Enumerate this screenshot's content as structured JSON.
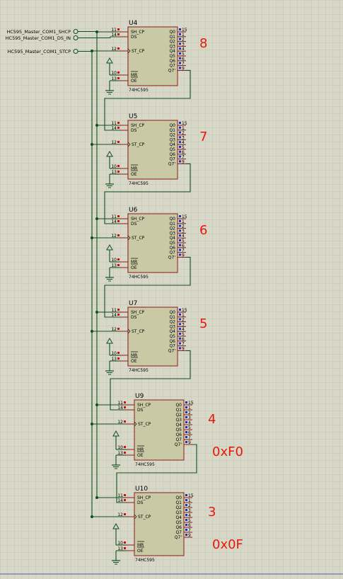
{
  "nets": [
    {
      "label": "HC595_Master_COM1_SHCP"
    },
    {
      "label": "HC595_Master_COM1_DS_IN"
    },
    {
      "label": "HC595_Master_COM1_STCP"
    }
  ],
  "chips": [
    {
      "ref": "U4",
      "part": "74HC595",
      "order": "8",
      "value": ""
    },
    {
      "ref": "U5",
      "part": "74HC595",
      "order": "7",
      "value": ""
    },
    {
      "ref": "U6",
      "part": "74HC595",
      "order": "6",
      "value": ""
    },
    {
      "ref": "U7",
      "part": "74HC595",
      "order": "5",
      "value": ""
    },
    {
      "ref": "U9",
      "part": "74HC595",
      "order": "4",
      "value": "0xF0"
    },
    {
      "ref": "U10",
      "part": "74HC595",
      "order": "3",
      "value": "0x0F"
    }
  ],
  "left_pins": [
    {
      "num": "11",
      "name": "SH_CP"
    },
    {
      "num": "14",
      "name": "DS"
    },
    {
      "num": "12",
      "name": "ST_CP"
    },
    {
      "num": "10",
      "name": "MR"
    },
    {
      "num": "13",
      "name": "OE"
    }
  ],
  "right_pins": [
    {
      "num": "15",
      "name": "Q0"
    },
    {
      "num": "1",
      "name": "Q1"
    },
    {
      "num": "2",
      "name": "Q2"
    },
    {
      "num": "3",
      "name": "Q3"
    },
    {
      "num": "4",
      "name": "Q4"
    },
    {
      "num": "5",
      "name": "Q5"
    },
    {
      "num": "6",
      "name": "Q6"
    },
    {
      "num": "7",
      "name": "Q7"
    },
    {
      "num": "9",
      "name": "Q7'"
    }
  ],
  "colors": {
    "background": "#d8d8c8",
    "grid": "#c4c4b2",
    "chip_fill": "#c9c9a6",
    "chip_border": "#8b1a1a",
    "wire": "#0f4f1f",
    "pin_marker_red": "#cc1111",
    "pin_marker_blue": "#2233aa",
    "annotation": "#e8180c"
  }
}
